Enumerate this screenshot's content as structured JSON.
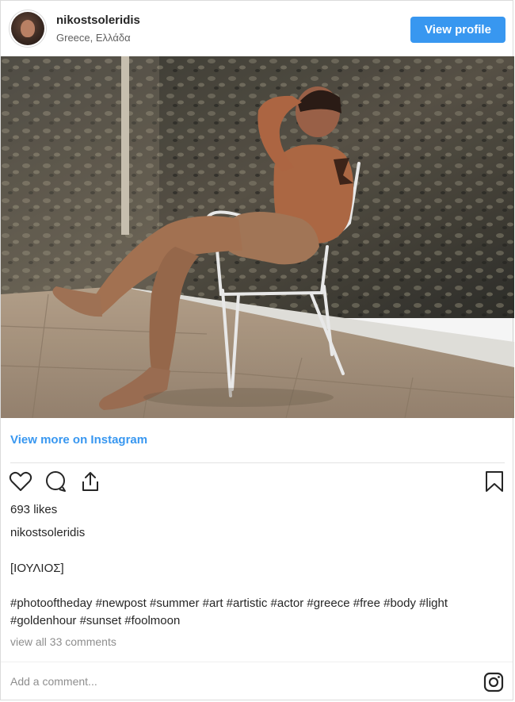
{
  "header": {
    "username": "nikostsoleridis",
    "location": "Greece, Ελλάδα",
    "view_profile_label": "View profile"
  },
  "photo": {
    "subject": "man-sitting-in-white-chair-outdoors"
  },
  "links": {
    "view_more": "View more on Instagram"
  },
  "actions": {
    "like_icon": "heart-icon",
    "comment_icon": "comment-icon",
    "share_icon": "share-icon",
    "save_icon": "bookmark-icon"
  },
  "post": {
    "likes": "693 likes",
    "caption_user": "nikostsoleridis",
    "caption_title": "[ΙΟΥΛΙΟΣ]",
    "hashtags": "#photooftheday #newpost #summer #art #artistic #actor #greece #free #body #light #goldenhour #sunset #foolmoon",
    "view_comments": "view all 33 comments"
  },
  "footer": {
    "add_comment_placeholder": "Add a comment...",
    "instagram_icon": "instagram-icon"
  },
  "colors": {
    "accent": "#3897f0",
    "text": "#262626",
    "muted": "#8e8e8e"
  }
}
